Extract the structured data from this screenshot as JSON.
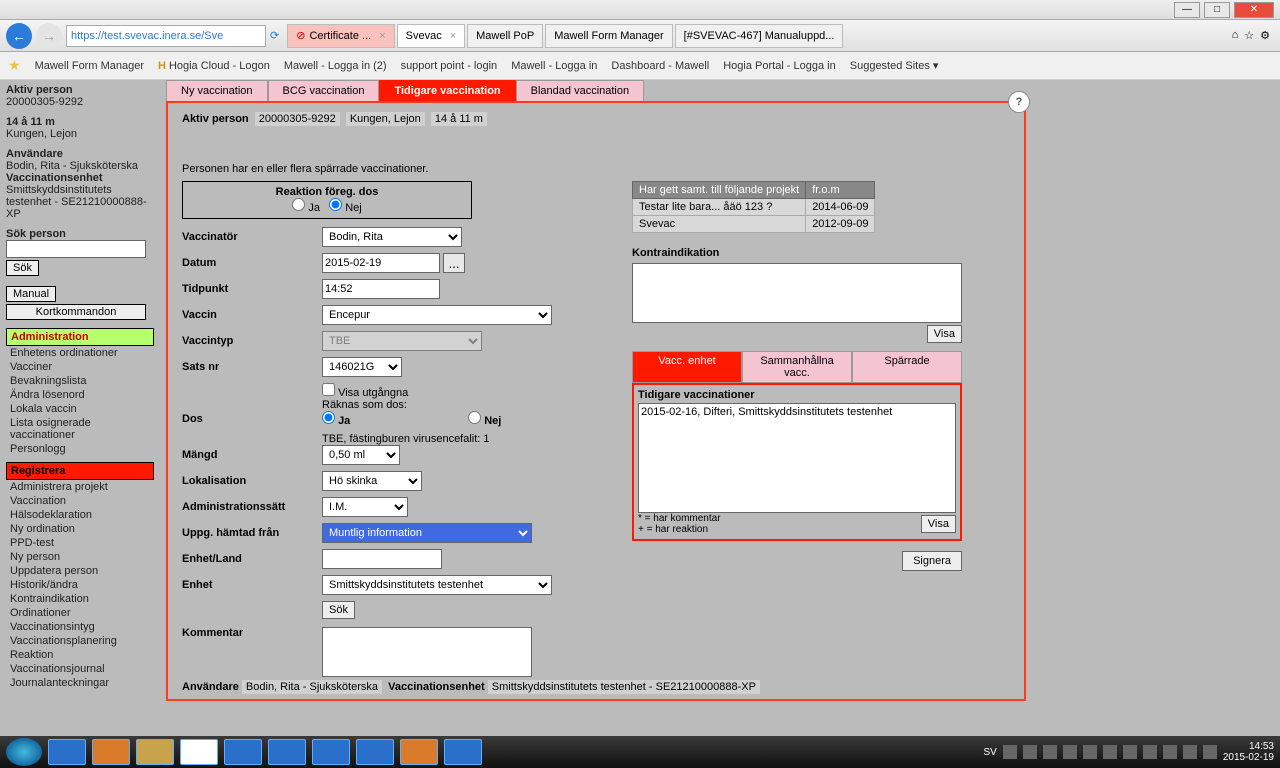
{
  "window": {
    "min": "—",
    "max": "□",
    "close": "✕"
  },
  "nav": {
    "back": "←",
    "fwd": "→",
    "url": "https://test.svevac.inera.se/Sve",
    "refresh": "⟳",
    "stop": "✕"
  },
  "browser_tabs": [
    {
      "label": "Certificate ...",
      "cert": true
    },
    {
      "label": "Svevac",
      "active": true
    },
    {
      "label": "Mawell PoP"
    },
    {
      "label": "Mawell Form Manager"
    },
    {
      "label": "[#SVEVAC-467] Manualuppd..."
    }
  ],
  "bookmarks": [
    "Mawell Form Manager",
    "Hogia Cloud - Logon",
    "Mawell - Logga in (2)",
    "support point - login",
    "Mawell - Logga in",
    "Dashboard - Mawell",
    "Hogia Portal - Logga in",
    "Suggested Sites ▾"
  ],
  "sidebar": {
    "aktiv_label": "Aktiv person",
    "aktiv_id": "20000305-9292",
    "age": "14 å 11 m",
    "name": "Kungen, Lejon",
    "anv_label": "Användare",
    "anv_val": "Bodin, Rita - Sjuksköterska",
    "vaccenh_label": "Vaccinationsenhet",
    "vaccenh_val": "Smittskyddsinstitutets testenhet - SE21210000888-XP",
    "sok_label": "Sök person",
    "sok_btn": "Sök",
    "manual_btn": "Manual",
    "kort_btn": "Kortkommandon",
    "admin_header": "Administration",
    "admin_items": [
      "Enhetens ordinationer",
      "Vacciner",
      "Bevakningslista",
      "Ändra lösenord",
      "Lokala vaccin",
      "Lista osignerade vaccinationer",
      "Personlogg"
    ],
    "reg_header": "Registrera",
    "reg_items": [
      "Administrera projekt",
      "Vaccination",
      "Hälsodeklaration",
      "Ny ordination",
      "PPD-test",
      "Ny person",
      "Uppdatera person",
      "Historik/ändra",
      "Kontraindikation",
      "Ordinationer",
      "Vaccinationsintyg",
      "Vaccinationsplanering",
      "Reaktion",
      "Vaccinationsjournal",
      "Journalanteckningar"
    ]
  },
  "main_tabs": [
    "Ny vaccination",
    "BCG vaccination",
    "Tidigare vaccination",
    "Blandad vaccination"
  ],
  "active_tab_idx": 2,
  "person_line": {
    "label": "Aktiv person",
    "id": "20000305-9292",
    "name": "Kungen, Lejon",
    "age": "14 å 11 m"
  },
  "sparrade_text": "Personen har en eller flera spärrade vaccinationer.",
  "reaction": {
    "title": "Reaktion föreg. dos",
    "ja": "Ja",
    "nej": "Nej",
    "selected": "nej"
  },
  "form": {
    "vaccinator_label": "Vaccinatör",
    "vaccinator_val": "Bodin, Rita",
    "datum_label": "Datum",
    "datum_val": "2015-02-19",
    "tidpunkt_label": "Tidpunkt",
    "tidpunkt_val": "14:52",
    "vaccin_label": "Vaccin",
    "vaccin_val": "Encepur",
    "vaccintyp_label": "Vaccintyp",
    "vaccintyp_val": "TBE",
    "sats_label": "Sats nr",
    "sats_val": "146021G",
    "visa_ut": "Visa utgångna",
    "raknas": "Räknas som dos:",
    "raknas_ja": "Ja",
    "raknas_nej": "Nej",
    "tbe_note": "TBE, fästingburen virusencefalit: 1",
    "dos_label": "Dos",
    "mangd_label": "Mängd",
    "mangd_val": "0,50 ml",
    "lokal_label": "Lokalisation",
    "lokal_val": "Hö skinka",
    "admin_label": "Administrationssätt",
    "admin_val": "I.M.",
    "uppg_label": "Uppg. hämtad från",
    "uppg_val": "Muntlig information",
    "enhetland_label": "Enhet/Land",
    "enhet_label": "Enhet",
    "enhet_val": "Smittskyddsinstitutets testenhet",
    "sok_btn": "Sök",
    "kommentar_label": "Kommentar"
  },
  "proj_table": {
    "h1": "Har gett samt. till följande projekt",
    "h2": "fr.o.m",
    "rows": [
      {
        "p": "Testar lite bara... åäö 123 ?",
        "d": "2014-06-09"
      },
      {
        "p": "Svevac",
        "d": "2012-09-09"
      }
    ]
  },
  "kontra_label": "Kontraindikation",
  "visa_btn": "Visa",
  "vacc_inner_tabs": [
    "Vacc. enhet",
    "Sammanhållna vacc.",
    "Spärrade"
  ],
  "prev_vacc_title": "Tidigare vaccinationer",
  "prev_vacc_item": "2015-02-16, Difteri, Smittskyddsinstitutets testenhet",
  "legend1": "* = har kommentar",
  "legend2": "+ = har reaktion",
  "signera": "Signera",
  "footer": {
    "anv_label": "Användare",
    "anv_val": "Bodin, Rita - Sjuksköterska",
    "enh_label": "Vaccinationsenhet",
    "enh_val": "Smittskyddsinstitutets testenhet - SE21210000888-XP"
  },
  "tray": {
    "lang": "SV",
    "time": "14:53",
    "date": "2015-02-19"
  }
}
